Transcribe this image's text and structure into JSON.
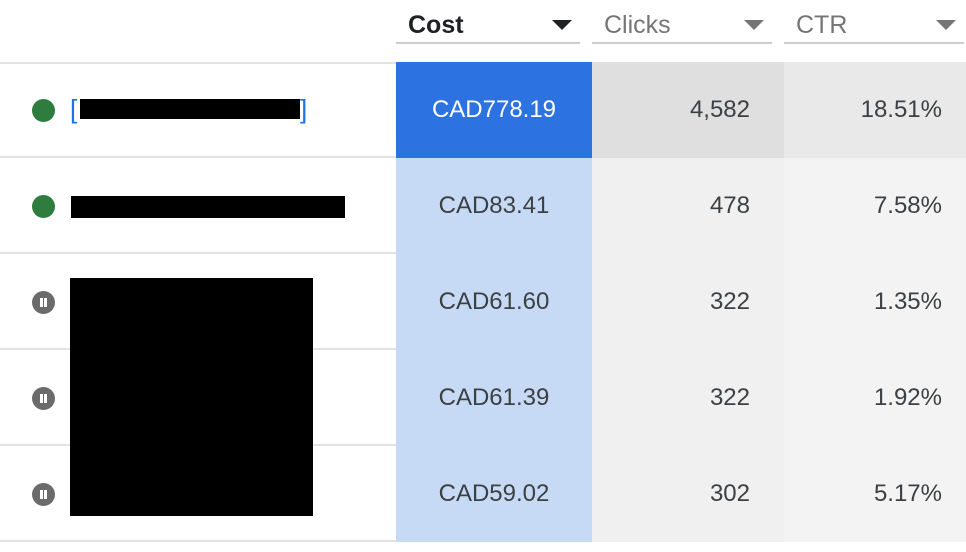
{
  "columns": {
    "cost": "Cost",
    "clicks": "Clicks",
    "ctr": "CTR"
  },
  "rows": [
    {
      "status": "enabled",
      "cost": "CAD778.19",
      "clicks": "4,582",
      "ctr": "18.51%"
    },
    {
      "status": "enabled",
      "cost": "CAD83.41",
      "clicks": "478",
      "ctr": "7.58%"
    },
    {
      "status": "paused",
      "cost": "CAD61.60",
      "clicks": "322",
      "ctr": "1.35%"
    },
    {
      "status": "paused",
      "cost": "CAD61.39",
      "clicks": "322",
      "ctr": "1.92%"
    },
    {
      "status": "paused",
      "cost": "CAD59.02",
      "clicks": "302",
      "ctr": "5.17%"
    }
  ],
  "colors": {
    "active_cost": "#2c72e0",
    "cost_column": "#c6daf5",
    "enabled_status": "#2e7d3e",
    "paused_status": "#6b6b6b"
  },
  "icons": {
    "enabled": "green-dot-icon",
    "paused": "pause-circle-icon",
    "sort": "caret-down-icon"
  }
}
